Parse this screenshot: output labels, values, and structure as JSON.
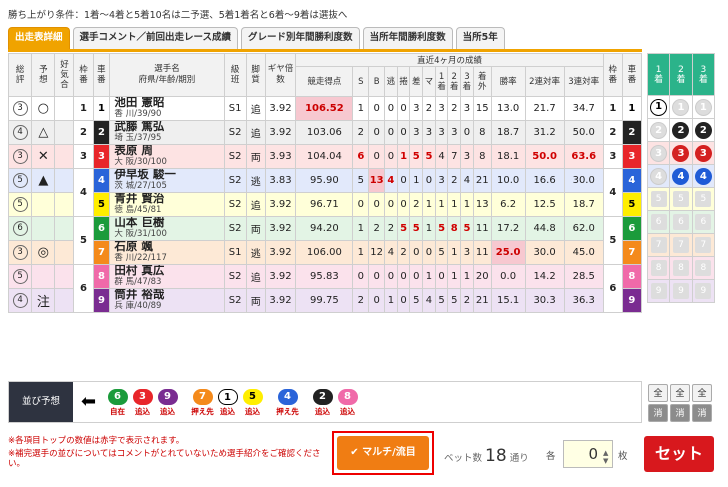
{
  "condition": "勝ち上がり条件：1着〜4着と5着10名は二予選、5着1着名と6着〜9着は選抜へ",
  "tabs": [
    "出走表詳細",
    "選手コメント／前回出走レース成績",
    "グレード別年間勝利度数",
    "当所年間勝利度数",
    "当所5年"
  ],
  "headers": {
    "sohyo": "総評",
    "yoso": "予想",
    "kokimochi": "好気合",
    "waku": "枠番",
    "sha": "車番",
    "name": "選手名",
    "name2": "府県/年齢/期別",
    "kyu": "級班",
    "kyaku": "脚質",
    "gear": "ギヤ倍数",
    "recent": "直近4ヶ月の成績",
    "score": "競走得点",
    "s": "S",
    "b": "B",
    "nige": "逃",
    "maku": "捲",
    "sashi": "差",
    "mark": "マ",
    "c1": "1着",
    "c2": "2着",
    "c3": "3着",
    "cout": "着外",
    "win": "勝率",
    "r2": "2連対率",
    "r3": "3連対率",
    "waku2": "枠番",
    "sha2": "車番",
    "p1": "1着",
    "p2": "2着",
    "p3": "3着"
  },
  "riders": [
    {
      "sohyo": "3",
      "yoso": "○",
      "waku": "1",
      "sha": "1",
      "name": "池田 憲昭",
      "info": "香 川/39/90",
      "kyu": "S1",
      "kyaku": "追",
      "gear": "3.92",
      "score": "106.52",
      "s": "1",
      "b": "0",
      "nige": "0",
      "maku": "0",
      "sashi": "3",
      "mark": "2",
      "c1": "3",
      "c2": "2",
      "c3": "3",
      "cout": "15",
      "win": "13.0",
      "r2": "21.7",
      "r3": "34.7"
    },
    {
      "sohyo": "4",
      "yoso": "△",
      "waku": "2",
      "sha": "2",
      "name": "武藤 篤弘",
      "info": "埼 玉/37/95",
      "kyu": "S2",
      "kyaku": "追",
      "gear": "3.92",
      "score": "103.06",
      "s": "2",
      "b": "0",
      "nige": "0",
      "maku": "0",
      "sashi": "3",
      "mark": "3",
      "c1": "3",
      "c2": "3",
      "c3": "0",
      "cout": "8",
      "win": "18.7",
      "r2": "31.2",
      "r3": "50.0"
    },
    {
      "sohyo": "3",
      "yoso": "✕",
      "waku": "3",
      "sha": "3",
      "name": "表原 周",
      "info": "大 阪/30/100",
      "kyu": "S2",
      "kyaku": "両",
      "gear": "3.93",
      "score": "104.04",
      "s": "6",
      "b": "0",
      "nige": "0",
      "maku": "1",
      "sashi": "5",
      "mark": "5",
      "c1": "4",
      "c2": "7",
      "c3": "3",
      "cout": "8",
      "win": "18.1",
      "r2": "50.0",
      "r3": "63.6"
    },
    {
      "sohyo": "5",
      "yoso": "▲",
      "waku": "4",
      "sha": "4",
      "name": "伊早坂 駿一",
      "info": "茨 城/27/105",
      "kyu": "S2",
      "kyaku": "逃",
      "gear": "3.83",
      "score": "95.90",
      "s": "5",
      "b": "13",
      "nige": "4",
      "maku": "0",
      "sashi": "1",
      "mark": "0",
      "c1": "3",
      "c2": "2",
      "c3": "4",
      "cout": "21",
      "win": "10.0",
      "r2": "16.6",
      "r3": "30.0"
    },
    {
      "sohyo": "5",
      "yoso": "",
      "waku": "4",
      "sha": "5",
      "name": "青井 賢治",
      "info": "徳 島/45/81",
      "kyu": "S2",
      "kyaku": "追",
      "gear": "3.92",
      "score": "96.71",
      "s": "0",
      "b": "0",
      "nige": "0",
      "maku": "0",
      "sashi": "2",
      "mark": "1",
      "c1": "1",
      "c2": "1",
      "c3": "1",
      "cout": "13",
      "win": "6.2",
      "r2": "12.5",
      "r3": "18.7"
    },
    {
      "sohyo": "6",
      "yoso": "",
      "waku": "5",
      "sha": "6",
      "name": "山本 巨樹",
      "info": "大 阪/31/100",
      "kyu": "S2",
      "kyaku": "両",
      "gear": "3.92",
      "score": "94.20",
      "s": "1",
      "b": "2",
      "nige": "2",
      "maku": "5",
      "sashi": "5",
      "mark": "1",
      "c1": "5",
      "c2": "8",
      "c3": "5",
      "cout": "11",
      "win": "17.2",
      "r2": "44.8",
      "r3": "62.0"
    },
    {
      "sohyo": "3",
      "yoso": "◎",
      "waku": "5",
      "sha": "7",
      "name": "石原 颯",
      "info": "香 川/22/117",
      "kyu": "S1",
      "kyaku": "逃",
      "gear": "3.92",
      "score": "106.00",
      "s": "1",
      "b": "12",
      "nige": "4",
      "maku": "2",
      "sashi": "0",
      "mark": "0",
      "c1": "5",
      "c2": "1",
      "c3": "3",
      "cout": "11",
      "win": "25.0",
      "r2": "30.0",
      "r3": "45.0"
    },
    {
      "sohyo": "5",
      "yoso": "",
      "waku": "6",
      "sha": "8",
      "name": "田村 真広",
      "info": "群 馬/47/83",
      "kyu": "S2",
      "kyaku": "追",
      "gear": "3.92",
      "score": "95.83",
      "s": "0",
      "b": "0",
      "nige": "0",
      "maku": "0",
      "sashi": "0",
      "mark": "1",
      "c1": "0",
      "c2": "1",
      "c3": "1",
      "cout": "20",
      "win": "0.0",
      "r2": "14.2",
      "r3": "28.5"
    },
    {
      "sohyo": "4",
      "yoso": "注",
      "waku": "6",
      "sha": "9",
      "name": "筒井 裕哉",
      "info": "兵 庫/40/89",
      "kyu": "S2",
      "kyaku": "両",
      "gear": "3.92",
      "score": "99.75",
      "s": "2",
      "b": "0",
      "nige": "1",
      "maku": "0",
      "sashi": "5",
      "mark": "4",
      "c1": "5",
      "c2": "5",
      "c3": "2",
      "cout": "21",
      "win": "15.1",
      "r2": "30.3",
      "r3": "36.3"
    }
  ],
  "prediction": {
    "label": "並び予想",
    "items": [
      {
        "n": "6",
        "l": "自在"
      },
      {
        "n": "3",
        "l": "追込"
      },
      {
        "n": "9",
        "l": "追込"
      },
      {
        "n": "7",
        "l": "押え先"
      },
      {
        "n": "1",
        "l": "追込"
      },
      {
        "n": "5",
        "l": "追込"
      },
      {
        "n": "4",
        "l": "押え先"
      },
      {
        "n": "2",
        "l": "追込"
      },
      {
        "n": "8",
        "l": "追込"
      }
    ]
  },
  "all_label": "全",
  "clear_label": "消",
  "notes": [
    "※各項目トップの数値は赤字で表示されます。",
    "※補完選手の並びについてはコメントがとれていないため選手紹介をご確認ください。"
  ],
  "multi_label": "マルチ/流目",
  "bets_label": "ベット数",
  "bets_count": "18",
  "bets_unit": "通り",
  "units_label": "各",
  "units_value": "0",
  "mai": "枚",
  "set_label": "セット"
}
